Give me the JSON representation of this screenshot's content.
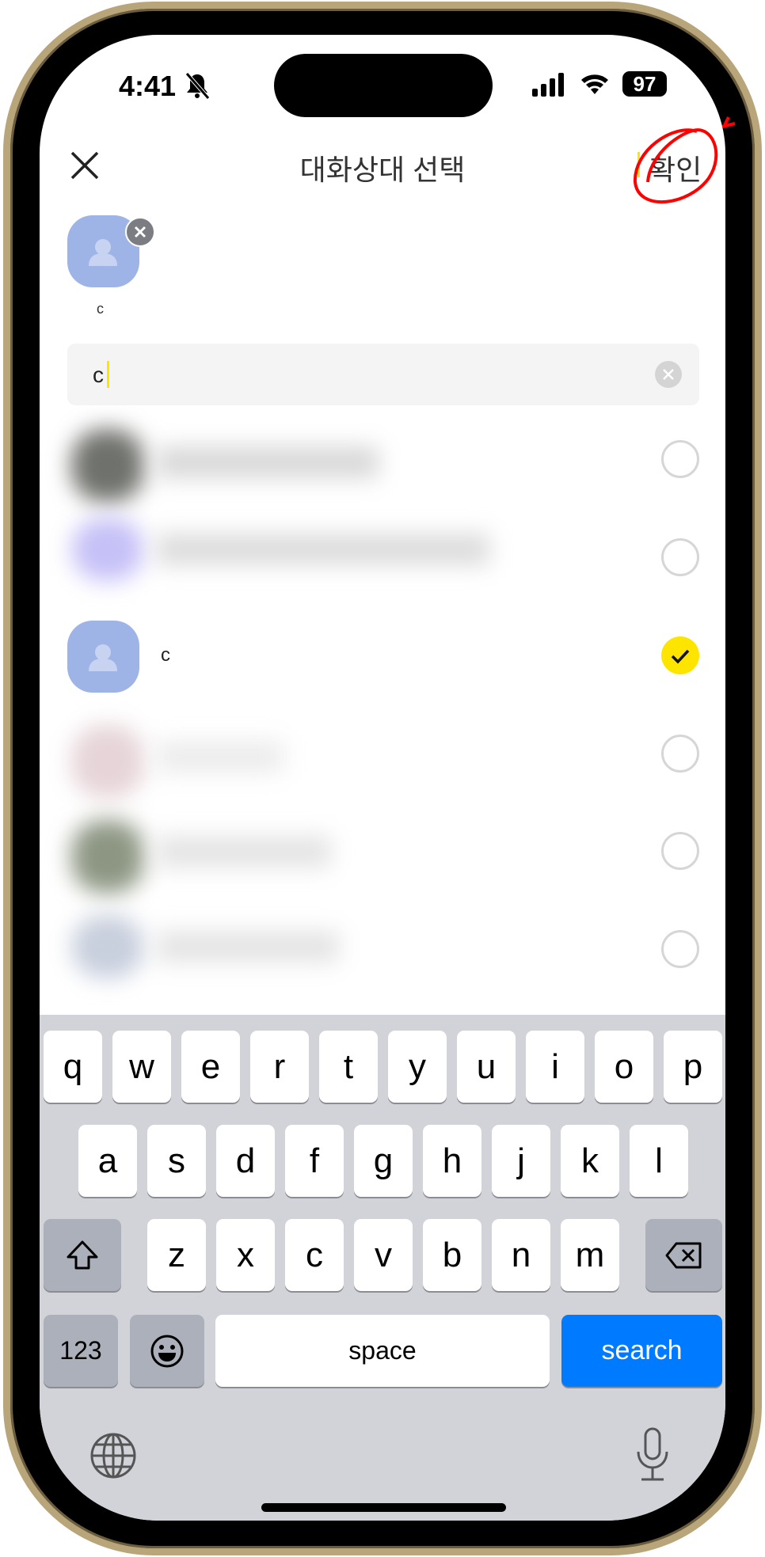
{
  "status_bar": {
    "time": "4:41",
    "silent_icon": "bell-slash-icon",
    "battery": "97"
  },
  "header": {
    "title": "대화상대 선택",
    "confirm_label": "확인",
    "close_icon": "close-icon"
  },
  "selected": [
    {
      "name": "c"
    }
  ],
  "search": {
    "value": "c"
  },
  "list": [
    {
      "name": "",
      "checked": false,
      "blurred": true
    },
    {
      "name": "",
      "checked": false,
      "blurred": true
    },
    {
      "name": "c",
      "checked": true,
      "blurred": false
    },
    {
      "name": "",
      "checked": false,
      "blurred": true
    },
    {
      "name": "",
      "checked": false,
      "blurred": true
    },
    {
      "name": "",
      "checked": false,
      "blurred": true
    }
  ],
  "colors": {
    "accent": "#fee500",
    "avatar": "#9fb4e6",
    "search_key": "#007aff",
    "annotation": "#ff0000"
  },
  "keyboard": {
    "row1": [
      "q",
      "w",
      "e",
      "r",
      "t",
      "y",
      "u",
      "i",
      "o",
      "p"
    ],
    "row2": [
      "a",
      "s",
      "d",
      "f",
      "g",
      "h",
      "j",
      "k",
      "l"
    ],
    "row3": [
      "z",
      "x",
      "c",
      "v",
      "b",
      "n",
      "m"
    ],
    "numbers": "123",
    "space": "space",
    "search": "search"
  }
}
